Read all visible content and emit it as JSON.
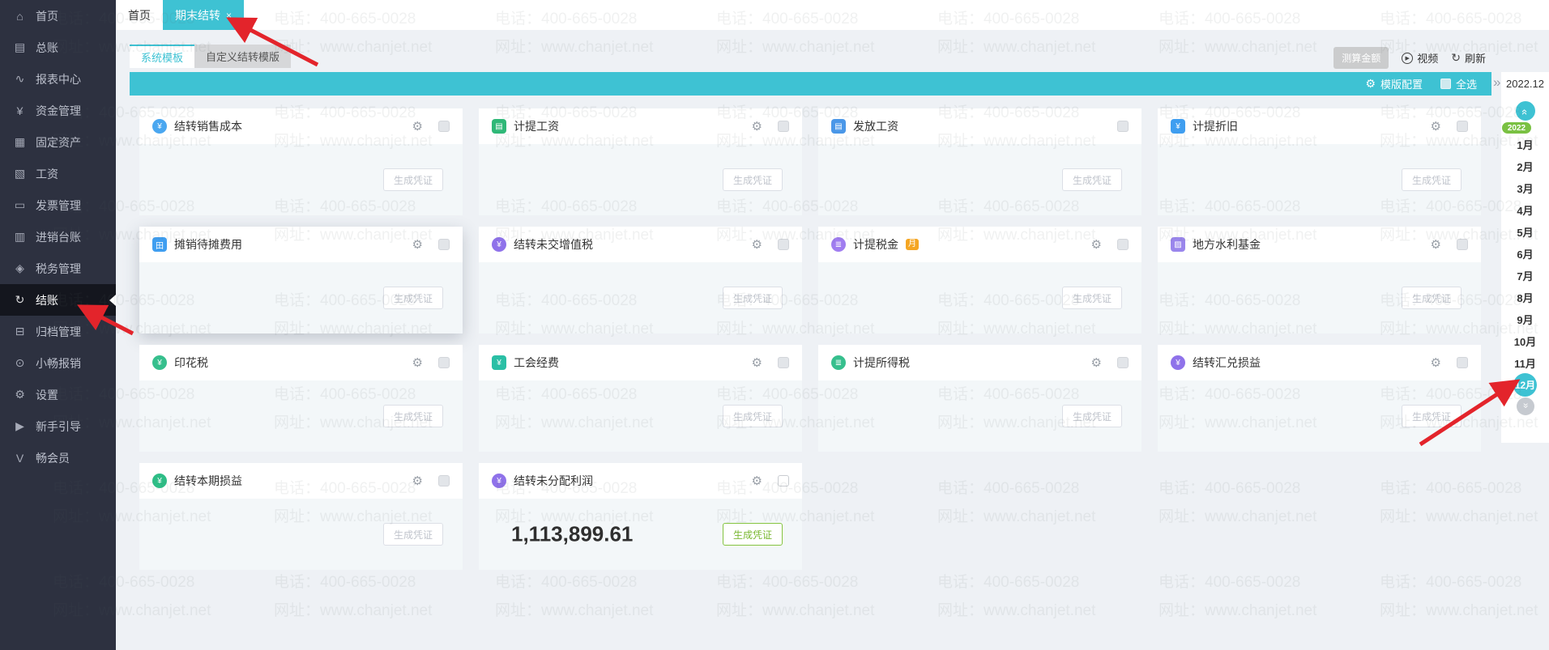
{
  "colors": {
    "accent": "#3ec2d3",
    "sidebar_bg": "#2d3140",
    "arrow": "#e3242b",
    "badge_orange": "#f5a623",
    "green_button": "#85c440",
    "year_pill_green": "#7ac143"
  },
  "sidebar": {
    "items": [
      {
        "label": "首页",
        "icon": "home-icon",
        "glyph": "⌂"
      },
      {
        "label": "总账",
        "icon": "general-ledger-icon",
        "glyph": "▤"
      },
      {
        "label": "报表中心",
        "icon": "report-center-icon",
        "glyph": "∿"
      },
      {
        "label": "资金管理",
        "icon": "funds-management-icon",
        "glyph": "¥"
      },
      {
        "label": "固定资产",
        "icon": "fixed-assets-icon",
        "glyph": "▦"
      },
      {
        "label": "工资",
        "icon": "payroll-icon",
        "glyph": "▧"
      },
      {
        "label": "发票管理",
        "icon": "invoice-management-icon",
        "glyph": "▭"
      },
      {
        "label": "进销台账",
        "icon": "purchase-sales-ledger-icon",
        "glyph": "▥"
      },
      {
        "label": "税务管理",
        "icon": "tax-management-icon",
        "glyph": "◈"
      },
      {
        "label": "结账",
        "icon": "closing-icon",
        "glyph": "↻",
        "active": true
      },
      {
        "label": "归档管理",
        "icon": "archive-management-icon",
        "glyph": "⊟"
      },
      {
        "label": "小畅报销",
        "icon": "expense-reimburse-icon",
        "glyph": "⊙"
      },
      {
        "label": "设置",
        "icon": "settings-icon",
        "glyph": "⚙"
      },
      {
        "label": "新手引导",
        "icon": "beginner-guide-icon",
        "glyph": "▶"
      },
      {
        "label": "畅会员",
        "icon": "member-icon",
        "glyph": "V"
      }
    ]
  },
  "tabs": [
    {
      "label": "首页",
      "active": false,
      "closable": false
    },
    {
      "label": "期末结转",
      "active": true,
      "closable": true,
      "close_glyph": "×"
    }
  ],
  "window": {
    "close_glyph": "×"
  },
  "template_tabs": [
    {
      "label": "系统模板",
      "active": true
    },
    {
      "label": "自定义结转模版",
      "active": false
    }
  ],
  "actions": {
    "estimate": "测算金额",
    "video": "视频",
    "video_glyph": "▶",
    "refresh": "刷新",
    "refresh_glyph": "↻"
  },
  "toolbar": {
    "template_config": "模版配置",
    "gear_glyph": "⚙",
    "select_all": "全选",
    "expander_glyph": "»"
  },
  "period": {
    "current": "2022.12",
    "year_badge": "2022",
    "months": [
      "1月",
      "2月",
      "3月",
      "4月",
      "5月",
      "6月",
      "7月",
      "8月",
      "9月",
      "10月",
      "11月",
      "12月"
    ],
    "selected_month": "12月",
    "up_glyph": "«",
    "down_glyph": "«"
  },
  "cards": [
    {
      "title": "结转销售成本",
      "icon": "sales-cost-icon",
      "glyph": "¥",
      "color": "#4aa7f0",
      "shape": "circle",
      "gear": true,
      "checkbox": "gray",
      "button": "生成凭证",
      "button_style": "default"
    },
    {
      "title": "计提工资",
      "icon": "accrue-payroll-icon",
      "glyph": "▤",
      "color": "#2fb877",
      "shape": "square",
      "gear": true,
      "checkbox": "gray",
      "button": "生成凭证",
      "button_style": "default"
    },
    {
      "title": "发放工资",
      "icon": "pay-salary-icon",
      "glyph": "▤",
      "color": "#4a97e8",
      "shape": "square",
      "gear": false,
      "checkbox": "gray",
      "button": "生成凭证",
      "button_style": "default"
    },
    {
      "title": "计提折旧",
      "icon": "depreciation-icon",
      "glyph": "¥",
      "color": "#3f9ef0",
      "shape": "square",
      "gear": true,
      "checkbox": "gray",
      "button": "生成凭证",
      "button_style": "default"
    },
    {
      "title": "摊销待摊费用",
      "icon": "amortization-icon",
      "glyph": "田",
      "color": "#3f9ef0",
      "shape": "square",
      "gear": true,
      "checkbox": "gray",
      "button": "生成凭证",
      "button_style": "default",
      "shadow": true
    },
    {
      "title": "结转未交增值税",
      "icon": "vat-carryover-icon",
      "glyph": "¥",
      "color": "#8f72ea",
      "shape": "circle",
      "gear": true,
      "checkbox": "gray",
      "button": "生成凭证",
      "button_style": "default"
    },
    {
      "title": "计提税金",
      "icon": "accrue-tax-icon",
      "glyph": "≣",
      "color": "#a07df0",
      "shape": "circle",
      "gear": true,
      "checkbox": "gray",
      "button": "生成凭证",
      "button_style": "default",
      "badge": "月"
    },
    {
      "title": "地方水利基金",
      "icon": "water-fund-icon",
      "glyph": "▨",
      "color": "#9a86ec",
      "shape": "square",
      "gear": true,
      "checkbox": "gray",
      "button": "生成凭证",
      "button_style": "default"
    },
    {
      "title": "印花税",
      "icon": "stamp-tax-icon",
      "glyph": "¥",
      "color": "#36bf8d",
      "shape": "circle",
      "gear": true,
      "checkbox": "gray",
      "button": "生成凭证",
      "button_style": "default"
    },
    {
      "title": "工会经费",
      "icon": "union-fund-icon",
      "glyph": "¥",
      "color": "#2abfa5",
      "shape": "square",
      "gear": true,
      "checkbox": "gray",
      "button": "生成凭证",
      "button_style": "default"
    },
    {
      "title": "计提所得税",
      "icon": "income-tax-icon",
      "glyph": "≣",
      "color": "#36bf8d",
      "shape": "circle",
      "gear": true,
      "checkbox": "gray",
      "button": "生成凭证",
      "button_style": "default"
    },
    {
      "title": "结转汇兑损益",
      "icon": "exchange-gain-loss-icon",
      "glyph": "¥",
      "color": "#8f72ea",
      "shape": "circle",
      "gear": true,
      "checkbox": "gray",
      "button": "生成凭证",
      "button_style": "default"
    },
    {
      "title": "结转本期损益",
      "icon": "period-profit-icon",
      "glyph": "¥",
      "color": "#2ebd86",
      "shape": "circle",
      "gear": true,
      "checkbox": "gray",
      "button": "生成凭证",
      "button_style": "default"
    },
    {
      "title": "结转未分配利润",
      "icon": "retained-profit-icon",
      "glyph": "¥",
      "color": "#8f72ea",
      "shape": "circle",
      "gear": true,
      "checkbox": "white",
      "button": "生成凭证",
      "button_style": "green",
      "amount": "1,113,899.61"
    }
  ],
  "watermark": {
    "line1": "电话：400-665-0028",
    "line2": "网址：www.chanjet.net"
  }
}
